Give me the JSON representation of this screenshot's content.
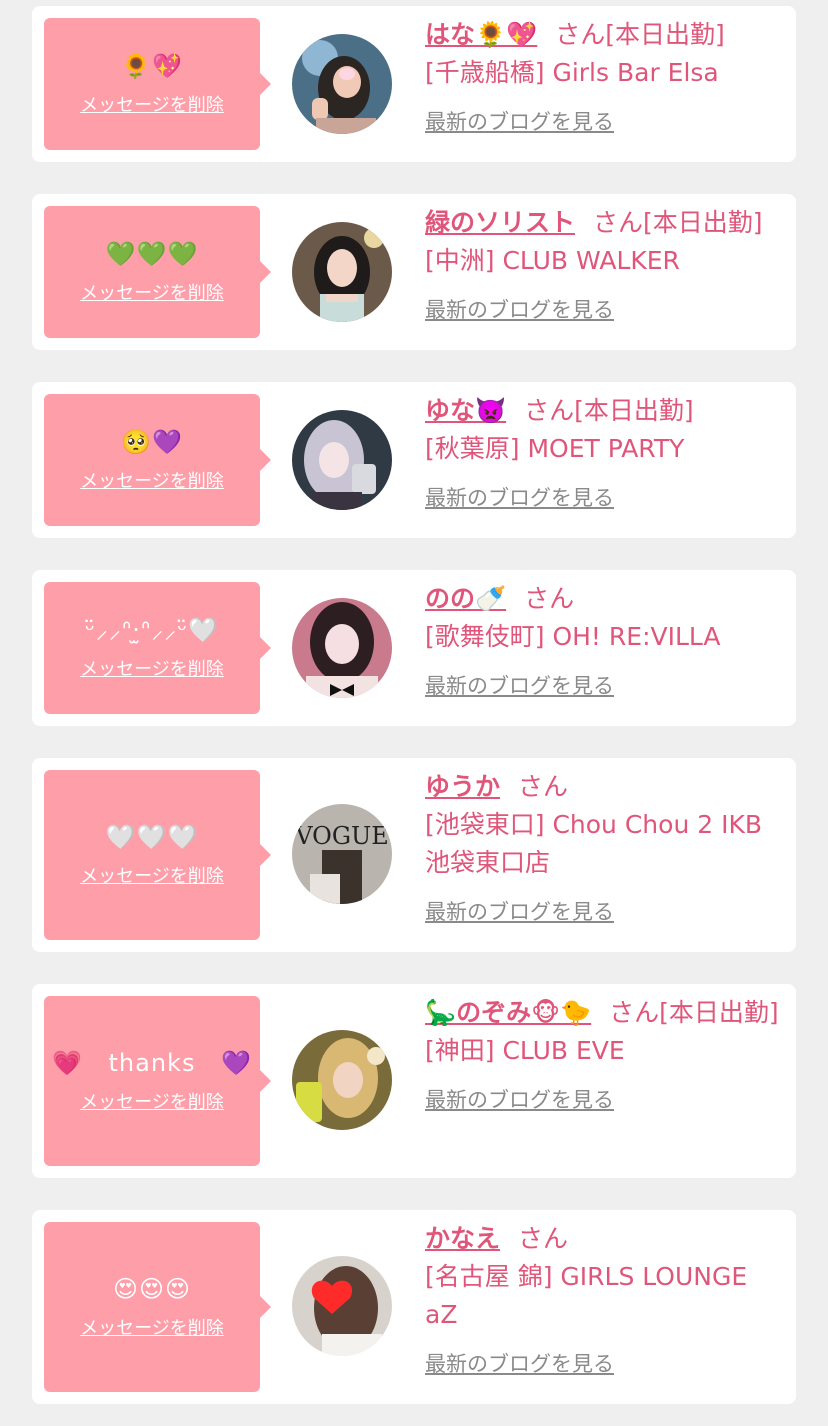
{
  "favorites": [
    {
      "message": "🌻💖",
      "delete_label": "メッセージを削除",
      "name": "はな🌻💖",
      "san_suffix": "さん[本日出勤]",
      "shop": "[千歳船橋] Girls Bar Elsa",
      "blog_link": "最新のブログを見る"
    },
    {
      "message": "💚💚💚",
      "delete_label": "メッセージを削除",
      "name": "緑のソリスト",
      "san_suffix": "さん[本日出勤]",
      "shop": "[中洲] CLUB WALKER",
      "blog_link": "最新のブログを見る"
    },
    {
      "message": "🥺💜",
      "delete_label": "メッセージを削除",
      "name": "ゆな👿",
      "san_suffix": "さん[本日出勤]",
      "shop": "[秋葉原] MOET PARTY",
      "blog_link": "最新のブログを見る"
    },
    {
      "message": "ᵕ̈⸝⸝ᐢ·̫ᐢ⸝⸝ᵕ̈🤍",
      "delete_label": "メッセージを削除",
      "name": "のの🍼",
      "san_suffix": "さん",
      "shop": "[歌舞伎町] OH! RE:VILLA",
      "blog_link": "最新のブログを見る"
    },
    {
      "message": "🤍🤍🤍",
      "delete_label": "メッセージを削除",
      "name": "ゆうか",
      "san_suffix": "さん",
      "shop": "[池袋東口] Chou Chou 2 IKB 池袋東口店",
      "blog_link": "最新のブログを見る"
    },
    {
      "message_left": "💗",
      "message": "thanks",
      "message_right": "💜",
      "delete_label": "メッセージを削除",
      "name": "🦕のぞみ🐵🐤",
      "san_suffix": "さん[本日出勤]",
      "shop": "[神田] CLUB EVE",
      "blog_link": "最新のブログを見る"
    },
    {
      "message": "😍😍😍",
      "delete_label": "メッセージを削除",
      "name": "かなえ",
      "san_suffix": "さん",
      "shop": "[名古屋 錦] GIRLS LOUNGE aZ",
      "blog_link": "最新のブログを見る"
    }
  ],
  "colors": {
    "background": "#efefef",
    "card": "#ffffff",
    "bubble": "#fe9ea9",
    "name_text": "#e0567a",
    "blog_link": "#8a8a8a"
  },
  "avatar_icons": [
    "avatar-photo",
    "avatar-photo",
    "avatar-photo",
    "avatar-photo",
    "avatar-photo",
    "avatar-photo",
    "avatar-photo"
  ]
}
